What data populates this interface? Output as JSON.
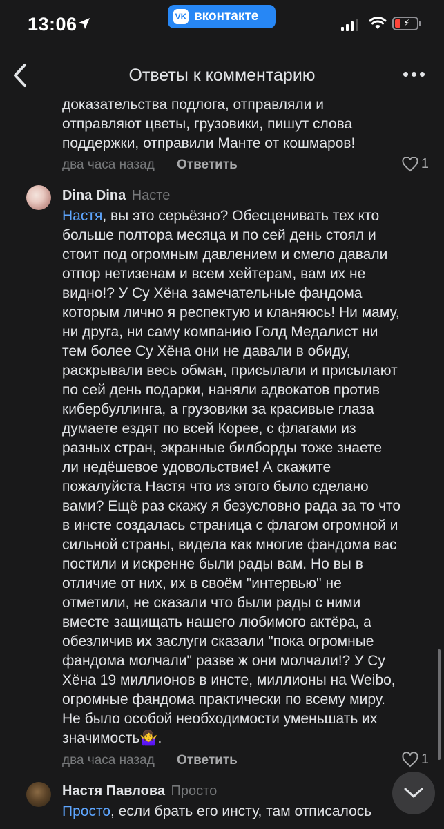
{
  "status": {
    "time": "13:06",
    "carrier_badge": "вконтакте"
  },
  "nav": {
    "title": "Ответы к комментарию"
  },
  "comments": [
    {
      "lines": [
        "доказательства подлога, отправляли и",
        "отправляют цветы, грузовики, пишут слова",
        "поддержки, отправили Манте от кошмаров!"
      ],
      "time": "два часа назад",
      "reply": "Ответить",
      "likes": "1"
    },
    {
      "author": "Dina Dina",
      "reply_to": "Насте",
      "mention": "Настя",
      "first_line_rest": ", вы это серьёзно? Обесценивать тех кто",
      "lines": [
        "больше полтора месяца и по сей день стоял и",
        "стоит под огромным давлением и смело давали",
        "отпор нетизенам и всем хейтерам, вам их не",
        "видно!? У Су Хёна замечательные фандома",
        "которым лично я респектую и кланяюсь! Ни маму,",
        "ни друга, ни саму компанию Голд Медалист ни",
        "тем более Су Хёна они не давали в обиду,",
        "раскрывали весь обман, присылали и присылают",
        "по сей день подарки, наняли адвокатов против",
        "кибербуллинга, а грузовики за красивые глаза",
        "думаете ездят по всей Корее, с флагами из",
        "разных стран, экранные билборды тоже знаете",
        "ли  недёшевое удовольствие! А скажите",
        "пожалуйста Настя что из этого было сделано",
        "вами? Ещё раз скажу я безусловно рада за то что",
        "в инсте создалась страница с флагом огромной и",
        "сильной страны, видела как многие фандома вас",
        "постили и искренне были рады вам. Но вы в",
        "отличие от них, их в своём \"интервью\" не",
        "отметили, не сказали что были рады с ними",
        "вместе защищать нашего любимого актёра, а",
        "обезличив их заслуги сказали \"пока огромные",
        "фандома молчали\" разве ж они молчали!? У Су",
        "Хёна 19 миллионов в инсте, миллионы на Weibo,",
        "огромные фандома практически по всему миру.",
        "Не было особой необходимости уменьшать их"
      ],
      "last_line": "значимость",
      "emoji": "🤷‍♀️",
      "last_line_end": ".",
      "time": "два часа назад",
      "reply": "Ответить",
      "likes": "1"
    },
    {
      "author": "Настя Павлова",
      "reply_to": "Просто",
      "mention": "Просто",
      "first_line_rest": ", если брать его инсту, там отписалось"
    }
  ],
  "icons": {
    "back": "chevron-left-icon",
    "more": "more-horizontal-icon",
    "like": "heart-outline-icon",
    "scroll_down": "chevron-down-icon"
  },
  "colors": {
    "background": "#19191a",
    "text": "#e1e3e6",
    "secondary": "#76787a",
    "link": "#5ea6ff",
    "vk_blue": "#2787f5"
  }
}
